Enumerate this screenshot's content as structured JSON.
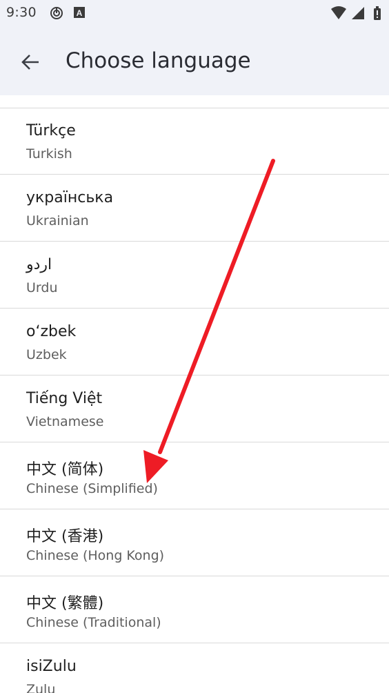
{
  "status_bar": {
    "time": "9:30",
    "icons": [
      "media-icon",
      "keyboard-a-icon",
      "wifi-icon",
      "signal-icon",
      "battery-icon"
    ]
  },
  "header": {
    "title": "Choose language",
    "back_icon": "arrow-back-icon"
  },
  "languages": [
    {
      "native": "Türkçe",
      "english": "Turkish"
    },
    {
      "native": "українська",
      "english": "Ukrainian"
    },
    {
      "native": "اردو",
      "english": "Urdu"
    },
    {
      "native": "oʻzbek",
      "english": "Uzbek"
    },
    {
      "native": "Tiếng Việt",
      "english": "Vietnamese"
    },
    {
      "native": "中文 (简体)",
      "english": "Chinese (Simplified)"
    },
    {
      "native": "中文 (香港)",
      "english": "Chinese (Hong Kong)"
    },
    {
      "native": "中文 (繁體)",
      "english": "Chinese (Traditional)"
    },
    {
      "native": "isiZulu",
      "english": "Zulu"
    }
  ],
  "annotation": {
    "type": "arrow",
    "color": "#ee1c25",
    "target_language": "Chinese (Simplified)"
  }
}
